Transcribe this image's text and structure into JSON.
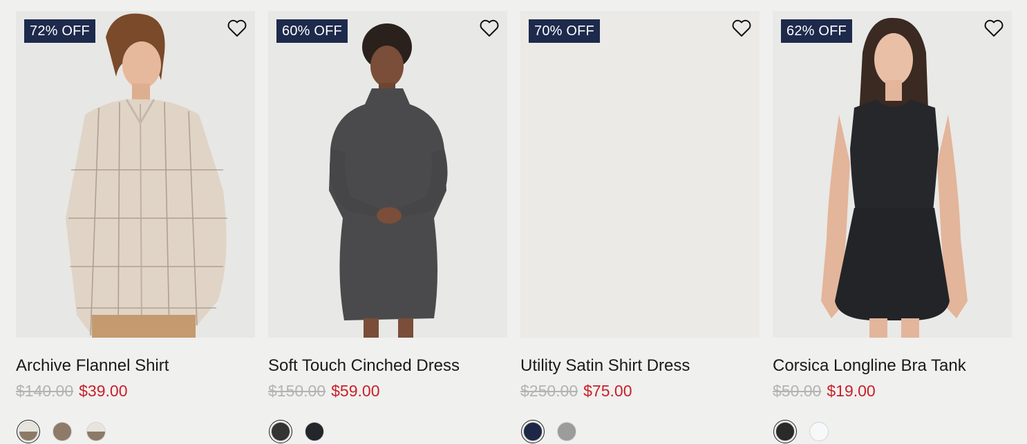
{
  "products": [
    {
      "badge": "72% OFF",
      "name": "Archive Flannel Shirt",
      "old_price": "$140.00",
      "new_price": "$39.00",
      "image": "model wearing beige plaid flannel shirt",
      "swatches": [
        {
          "top": "#e7e4de",
          "bottom": "#8c7a67",
          "selected": true
        },
        {
          "top": "#8e7a68",
          "bottom": "#8e7a68",
          "selected": false
        },
        {
          "top": "#e7e4de",
          "bottom": "#8c7a67",
          "selected": false
        }
      ]
    },
    {
      "badge": "60% OFF",
      "name": "Soft Touch Cinched Dress",
      "old_price": "$150.00",
      "new_price": "$59.00",
      "image": "model wearing charcoal mock-neck dress",
      "swatches": [
        {
          "top": "#343434",
          "bottom": "#343434",
          "selected": true
        },
        {
          "top": "#23262b",
          "bottom": "#23262b",
          "selected": false
        }
      ]
    },
    {
      "badge": "70% OFF",
      "name": "Utility Satin Shirt Dress",
      "old_price": "$250.00",
      "new_price": "$75.00",
      "image": "",
      "swatches": [
        {
          "top": "#1e2746",
          "bottom": "#1e2746",
          "selected": true
        },
        {
          "top": "#9c9c9c",
          "bottom": "#9c9c9c",
          "selected": false
        }
      ]
    },
    {
      "badge": "62% OFF",
      "name": "Corsica Longline Bra Tank",
      "old_price": "$50.00",
      "new_price": "$19.00",
      "image": "model wearing black sleeveless tank and skirt",
      "swatches": [
        {
          "top": "#2a2a2a",
          "bottom": "#2a2a2a",
          "selected": true
        },
        {
          "top": "#f6f8fa",
          "bottom": "#f6f8fa",
          "selected": false
        }
      ]
    }
  ]
}
